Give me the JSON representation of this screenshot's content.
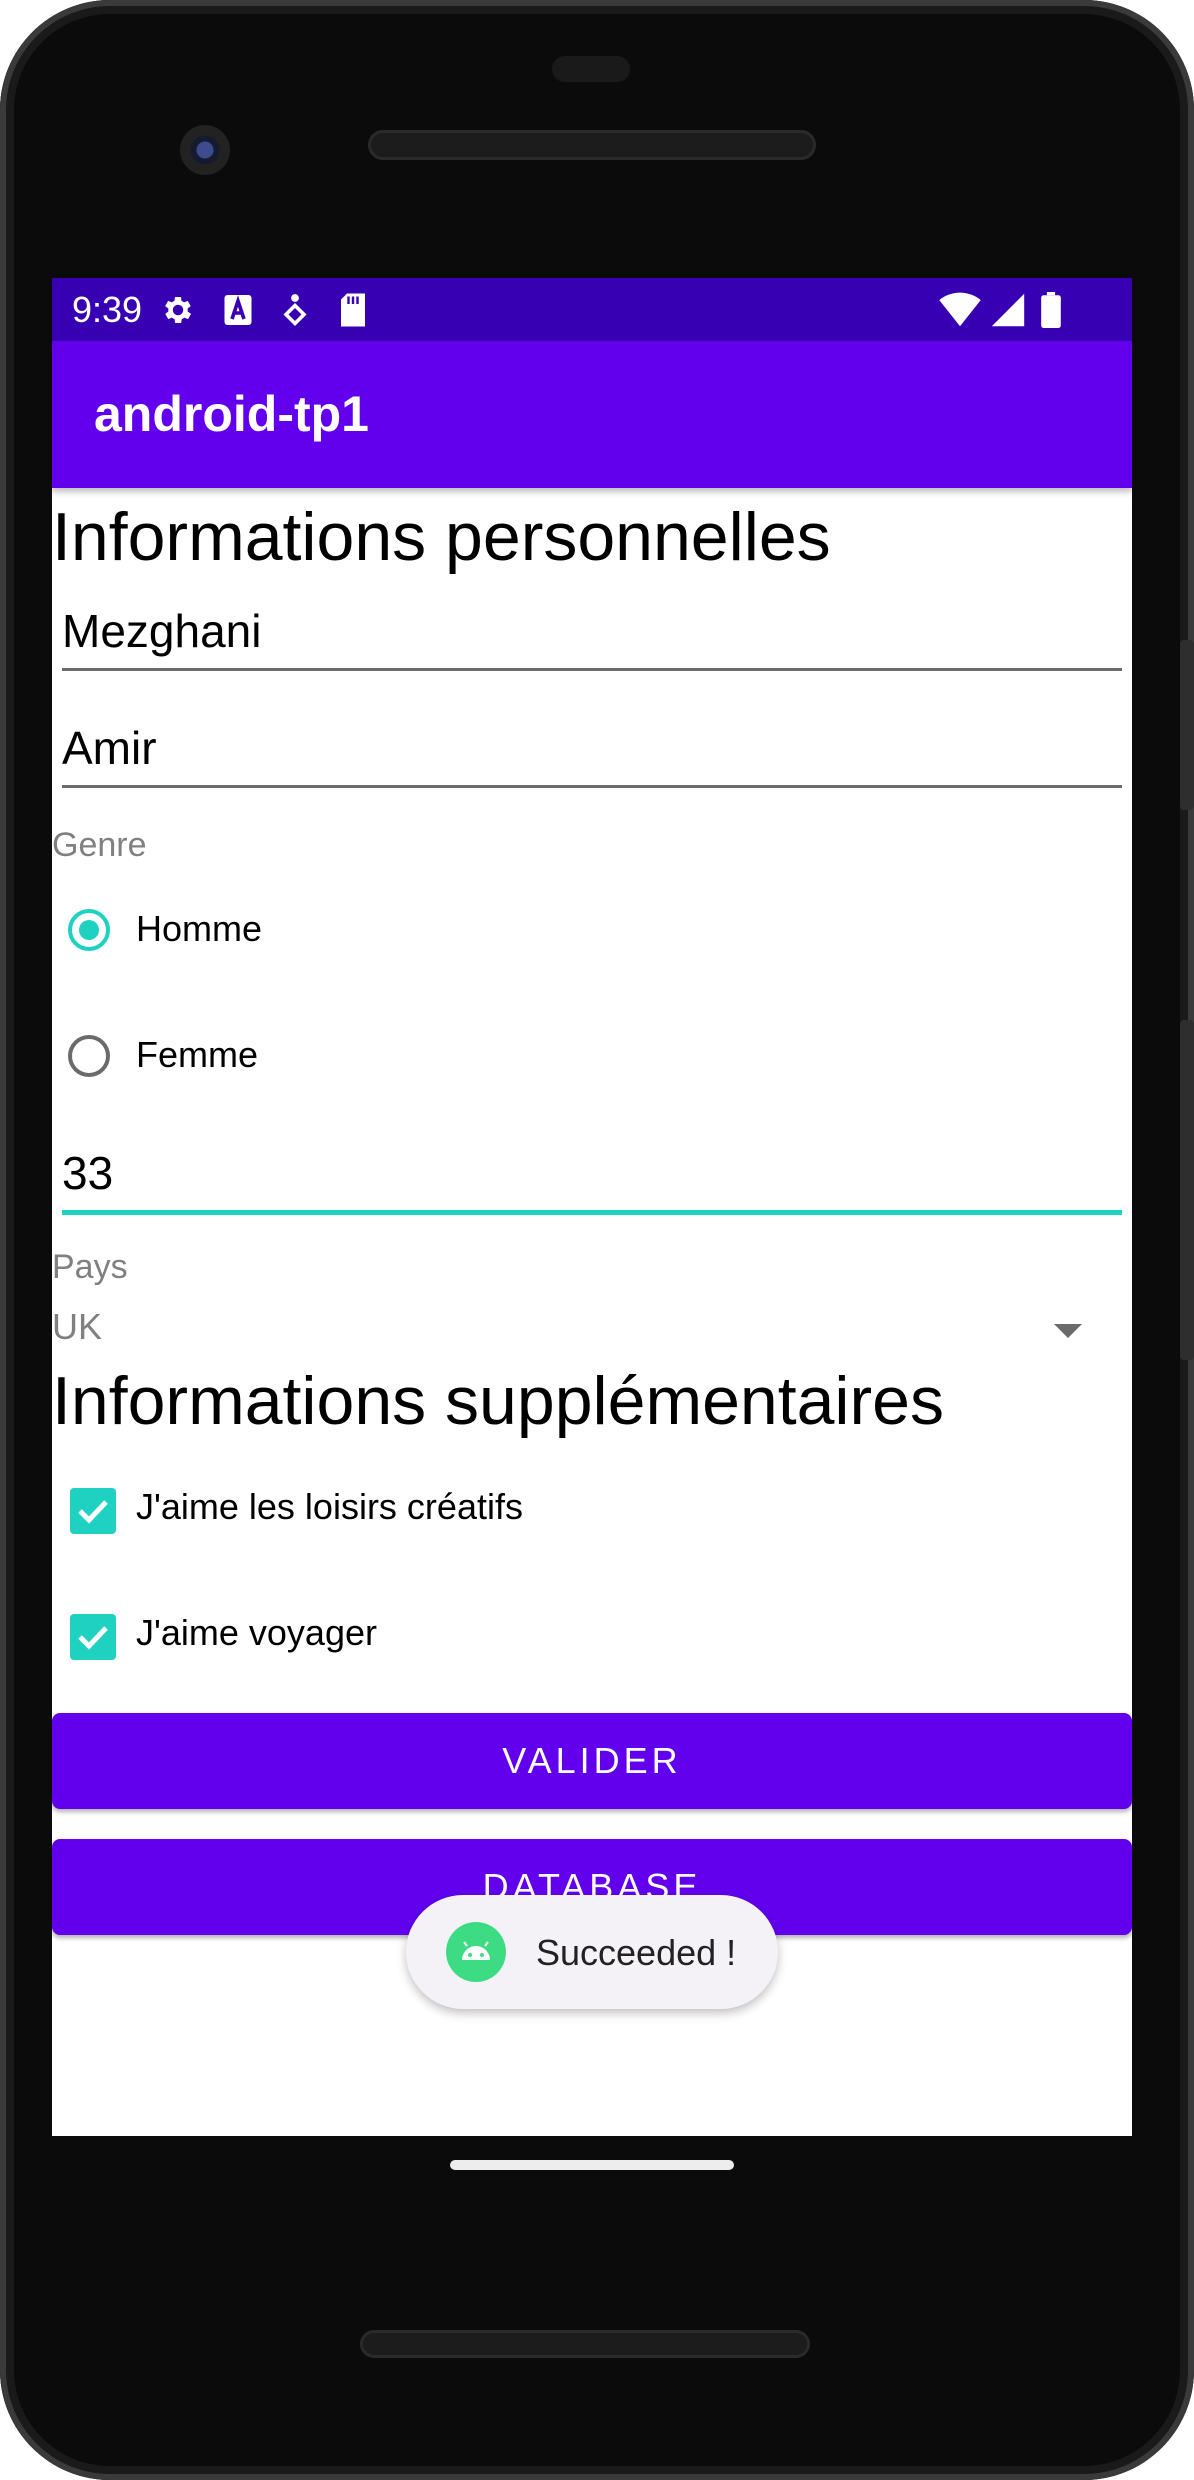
{
  "status_bar": {
    "time": "9:39"
  },
  "app_bar": {
    "title": "android-tp1"
  },
  "personal": {
    "heading": "Informations personnelles",
    "last_name_value": "Mezghani",
    "first_name_value": "Amir",
    "gender_label": "Genre",
    "gender_options": [
      "Homme",
      "Femme"
    ],
    "gender_selected": "Homme",
    "age_value": "33",
    "country_label": "Pays",
    "country_value": "UK"
  },
  "extra": {
    "heading": "Informations supplémentaires",
    "checkboxes": [
      {
        "label": "J'aime les loisirs créatifs",
        "checked": true
      },
      {
        "label": "J'aime voyager",
        "checked": true
      }
    ]
  },
  "buttons": {
    "validate": "VALIDER",
    "database": "DATABASE"
  },
  "toast": {
    "text": "Succeeded !"
  },
  "colors": {
    "status_bar": "#3700b3",
    "primary": "#6200ee",
    "accent": "#1fd1c0"
  }
}
